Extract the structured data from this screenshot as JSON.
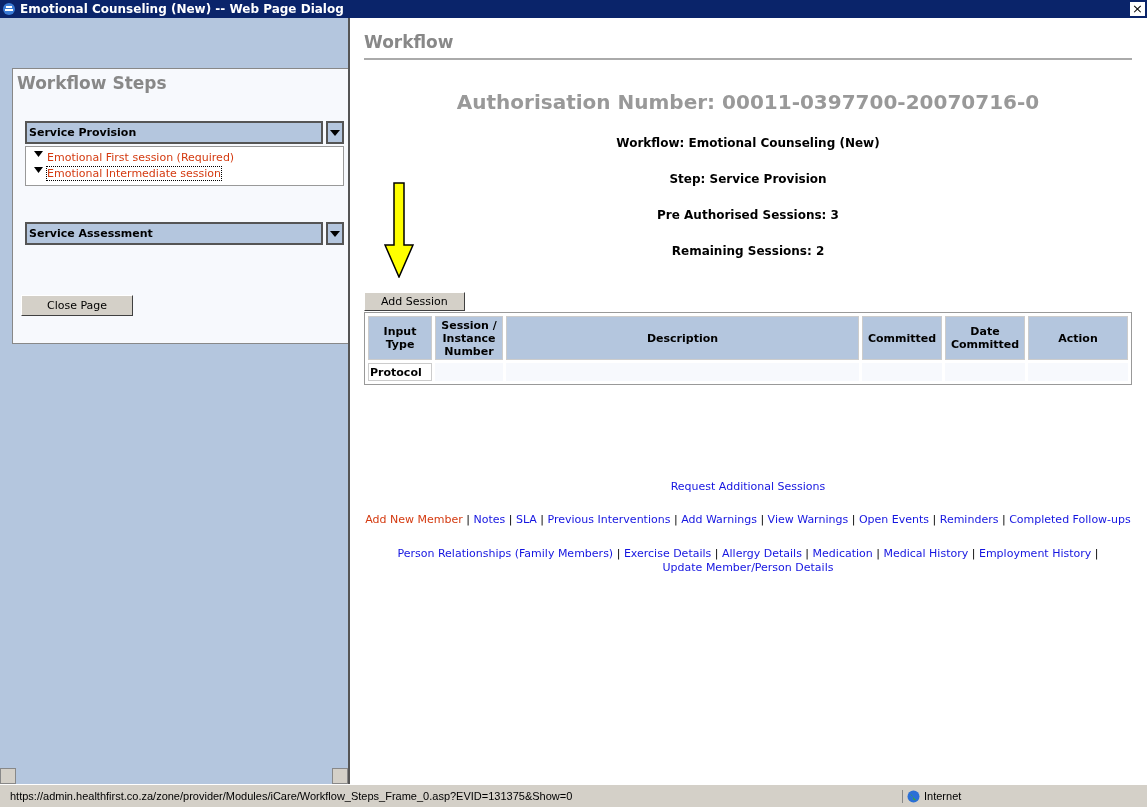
{
  "window": {
    "title": "Emotional Counseling (New) -- Web Page Dialog",
    "close": "×"
  },
  "sidebar": {
    "title": "Workflow Steps",
    "groups": [
      {
        "label": "Service Provision",
        "items": [
          {
            "label": "Emotional First session (Required)",
            "focused": false
          },
          {
            "label": "Emotional Intermediate session",
            "focused": true
          }
        ]
      },
      {
        "label": "Service Assessment"
      }
    ],
    "close_button": "Close Page"
  },
  "main": {
    "title": "Workflow",
    "authorisation": "Authorisation Number: 00011-0397700-20070716-0",
    "info": [
      "Workflow: Emotional Counseling (New)",
      "Step: Service Provision",
      "Pre Authorised Sessions: 3",
      "Remaining Sessions: 2"
    ],
    "add_button": "Add Session",
    "table": {
      "columns": [
        "Input Type",
        "Session / Instance Number",
        "Description",
        "Committed",
        "Date Committed",
        "Action"
      ],
      "rows": [
        [
          "Protocol",
          "",
          "",
          "",
          "",
          ""
        ]
      ]
    },
    "request_link": "Request Additional Sessions",
    "link_rows": [
      [
        {
          "kind": "link",
          "text": "Add New Member",
          "visited": true
        },
        {
          "kind": "separator",
          "text": "|"
        },
        {
          "kind": "link",
          "text": "Notes",
          "visited": false
        },
        {
          "kind": "separator",
          "text": "|"
        },
        {
          "kind": "link",
          "text": "SLA",
          "visited": false
        },
        {
          "kind": "separator",
          "text": "|"
        },
        {
          "kind": "link",
          "text": "Previous Interventions",
          "visited": false
        },
        {
          "kind": "separator",
          "text": "|"
        },
        {
          "kind": "link",
          "text": "Add Warnings",
          "visited": false
        },
        {
          "kind": "separator",
          "text": "|"
        },
        {
          "kind": "link",
          "text": "View Warnings",
          "visited": false
        },
        {
          "kind": "separator",
          "text": "|"
        },
        {
          "kind": "link",
          "text": "Open Events",
          "visited": false
        },
        {
          "kind": "separator",
          "text": "|"
        },
        {
          "kind": "link",
          "text": "Reminders",
          "visited": false
        },
        {
          "kind": "separator",
          "text": "|"
        },
        {
          "kind": "link",
          "text": "Completed Follow-ups",
          "visited": false
        }
      ],
      [
        {
          "kind": "link",
          "text": "Person Relationships (Family Members)",
          "visited": false
        },
        {
          "kind": "separator",
          "text": "|"
        },
        {
          "kind": "link",
          "text": "Exercise Details",
          "visited": false
        },
        {
          "kind": "separator",
          "text": "|"
        },
        {
          "kind": "link",
          "text": "Allergy Details",
          "visited": false
        },
        {
          "kind": "separator",
          "text": "|"
        },
        {
          "kind": "link",
          "text": "Medication",
          "visited": false
        },
        {
          "kind": "separator",
          "text": "|"
        },
        {
          "kind": "link",
          "text": "Medical History",
          "visited": false
        },
        {
          "kind": "separator",
          "text": "|"
        },
        {
          "kind": "link",
          "text": "Employment History",
          "visited": false
        },
        {
          "kind": "separator",
          "text": "|"
        },
        {
          "kind": "link",
          "text": "Update Member/Person Details",
          "visited": false
        }
      ]
    ]
  },
  "status_bar": {
    "url": "https://admin.healthfirst.co.za/zone/provider/Modules/iCare/Workflow_Steps_Frame_0.asp?EVID=131375&Show=0",
    "zone": "Internet"
  }
}
